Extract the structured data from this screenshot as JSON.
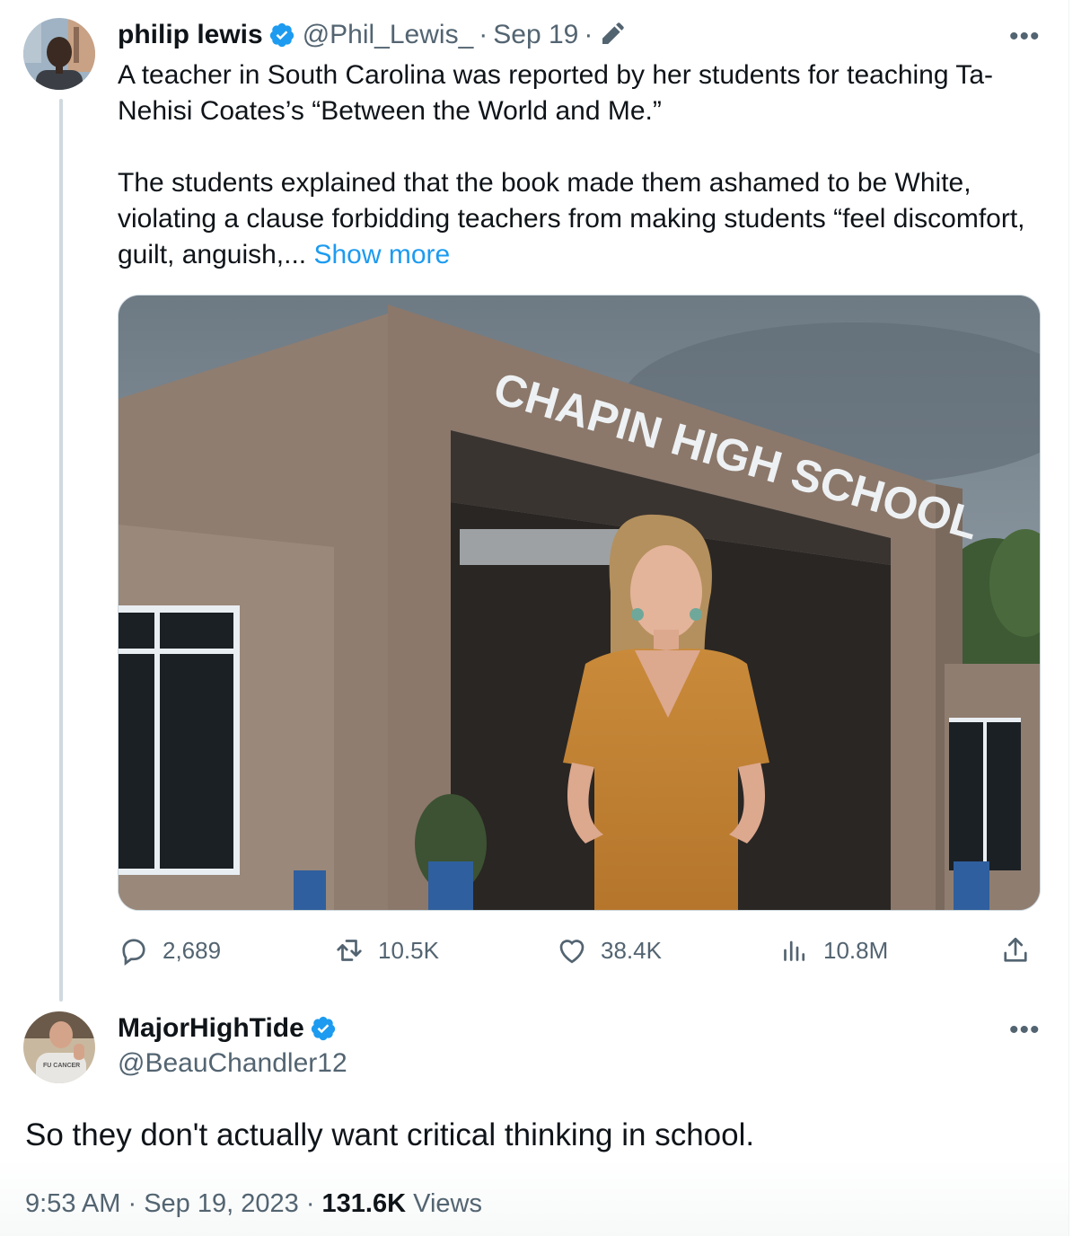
{
  "tweet": {
    "author_name": "philip lewis",
    "handle": "@Phil_Lewis_",
    "separator": "·",
    "date": "Sep 19",
    "separator2": "·",
    "edit_icon": "pencil-icon",
    "verified_icon": "verified-badge-icon",
    "more_icon": "more-options-icon",
    "text_p1": "A teacher in South Carolina was reported by her students for teaching Ta-Nehisi Coates’s “Between the World and Me.”",
    "text_p2": "The students explained that the book made them ashamed to be White, violating a clause forbidding teachers from making students “feel discomfort, guilt, anguish,...",
    "show_more": "Show more",
    "media_sign": "CHAPIN HIGH SCHOOL",
    "stats": {
      "replies": "2,689",
      "reposts": "10.5K",
      "likes": "38.4K",
      "views": "10.8M"
    }
  },
  "reply": {
    "author_name": "MajorHighTide",
    "handle": "@BeauChandler12",
    "text": "So they don't actually want critical thinking in school.",
    "avatar_shirt_text": "FU CANCER",
    "time": "9:53 AM",
    "sep1": "·",
    "date": "Sep 19, 2023",
    "sep2": "·",
    "views_count": "131.6K",
    "views_label": "Views"
  },
  "colors": {
    "accent": "#1d9bf0",
    "muted": "#536471",
    "text": "#0f1419",
    "verified": "#1d9bf0"
  }
}
